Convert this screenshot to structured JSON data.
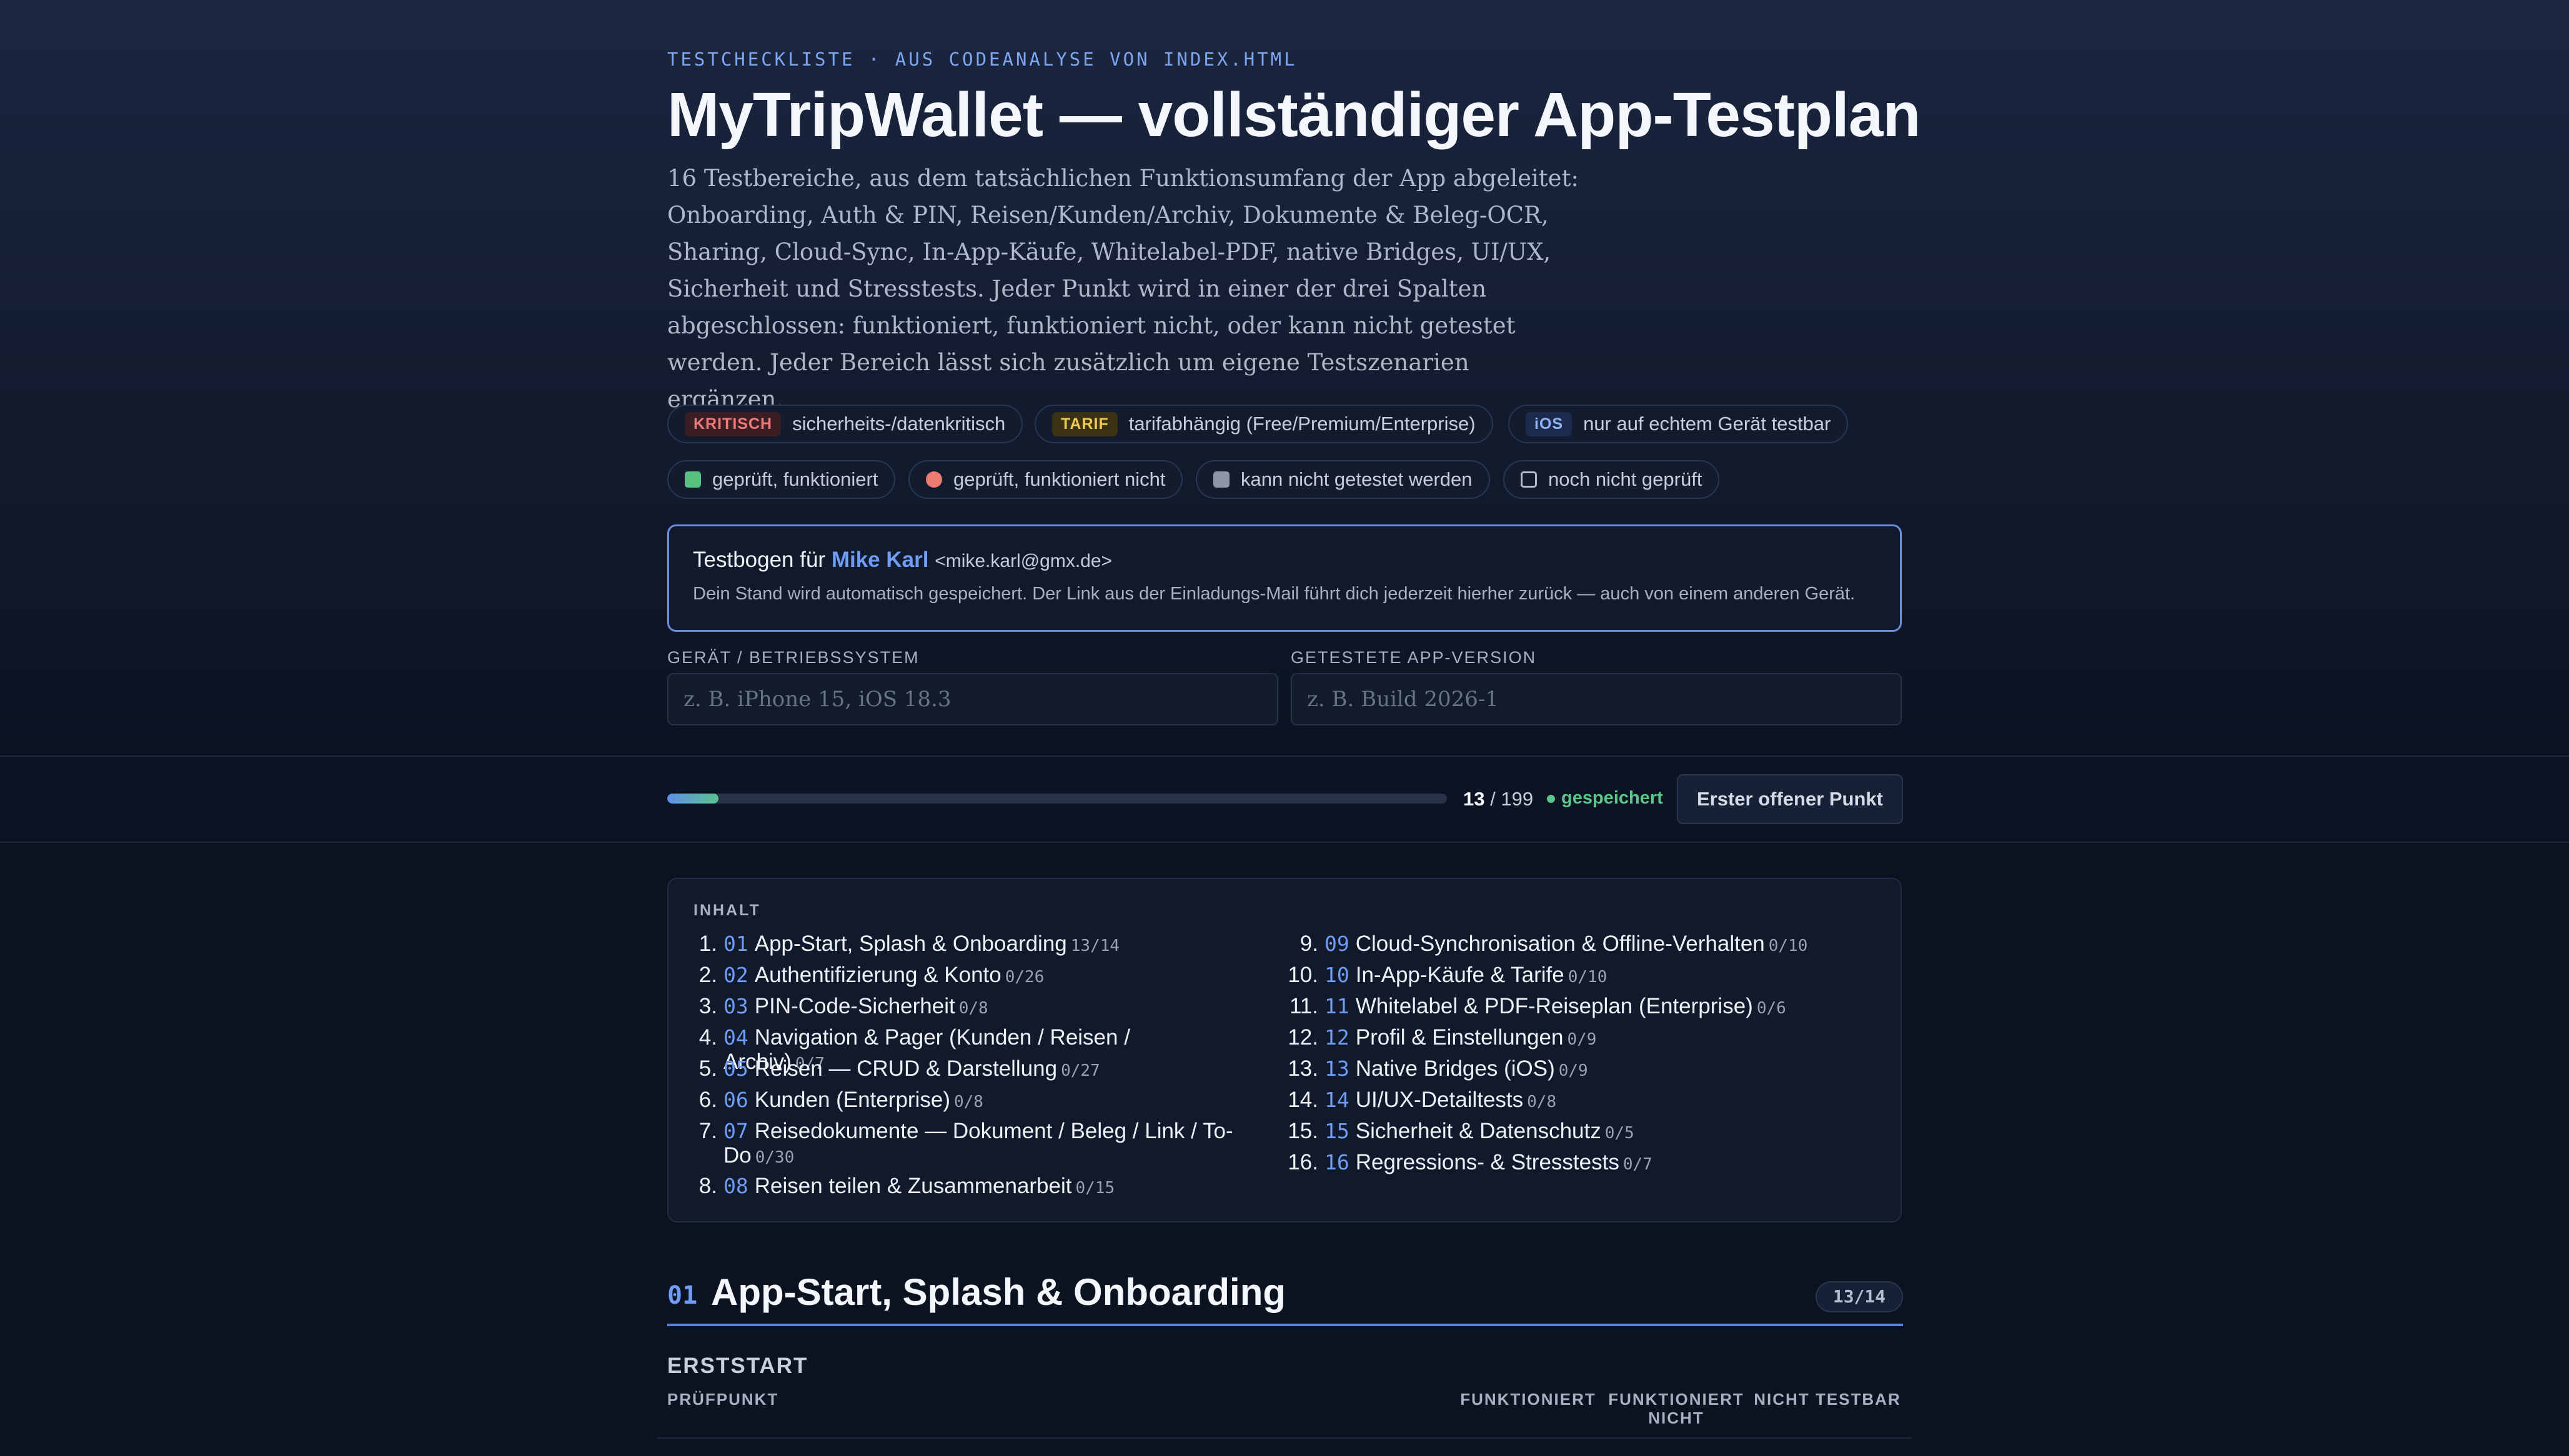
{
  "header": {
    "kicker": "TESTCHECKLISTE · AUS CODEANALYSE VON INDEX.HTML",
    "title": "MyTripWallet — vollständiger App-Testplan",
    "intro": "16 Testbereiche, aus dem tatsächlichen Funktionsumfang der App abgeleitet: Onboarding, Auth & PIN, Reisen/Kunden/Archiv, Dokumente & Beleg-OCR, Sharing, Cloud-Sync, In-App-Käufe, Whitelabel-PDF, native Bridges, UI/UX, Sicherheit und Stresstests. Jeder Punkt wird in einer der drei Spalten abgeschlossen: funktioniert, funktioniert nicht, oder kann nicht getestet werden. Jeder Bereich lässt sich zusätzlich um eigene Testszenarien ergänzen."
  },
  "legend": {
    "tags": [
      {
        "tag": "KRITISCH",
        "text": "sicherheits-/datenkritisch",
        "color": "#f07a7a"
      },
      {
        "tag": "TARIF",
        "text": "tarifabhängig (Free/Premium/Enterprise)",
        "color": "#f2cb55"
      },
      {
        "tag": "iOS",
        "text": "nur auf echtem Gerät testbar",
        "color": "#8fb3f5"
      }
    ],
    "states": [
      {
        "text": "geprüft, funktioniert",
        "color": "#55c07f"
      },
      {
        "text": "geprüft, funktioniert nicht",
        "color": "#ec7c72"
      },
      {
        "text": "kann nicht getestet werden",
        "color": "#8d97a8"
      },
      {
        "text": "noch nicht geprüft",
        "color": "transparent"
      }
    ]
  },
  "invite": {
    "prefix": "Testbogen für",
    "name": "Mike Karl",
    "email": "<mike.karl@gmx.de>",
    "note": "Dein Stand wird automatisch gespeichert. Der Link aus der Einladungs-Mail führt dich jederzeit hierher zurück — auch von einem anderen Gerät."
  },
  "fields": {
    "device_label": "GERÄT / BETRIEBSSYSTEM",
    "device_value": "",
    "device_placeholder": "z. B. iPhone 15, iOS 18.3",
    "version_label": "GETESTETE APP-VERSION",
    "version_value": "",
    "version_placeholder": "z. B. Build 2026-1"
  },
  "progress": {
    "done": 13,
    "total": 199,
    "separator": "/",
    "saved_label": "gespeichert",
    "jump_label": "Erster offener Punkt"
  },
  "toc": {
    "heading": "INHALT",
    "items": [
      {
        "idx": "1.",
        "num": "01",
        "label": "App-Start, Splash & Onboarding",
        "count": "13/14"
      },
      {
        "idx": "2.",
        "num": "02",
        "label": "Authentifizierung & Konto",
        "count": "0/26"
      },
      {
        "idx": "3.",
        "num": "03",
        "label": "PIN-Code-Sicherheit",
        "count": "0/8"
      },
      {
        "idx": "4.",
        "num": "04",
        "label": "Navigation & Pager (Kunden / Reisen / Archiv)",
        "count": "0/7"
      },
      {
        "idx": "5.",
        "num": "05",
        "label": "Reisen — CRUD & Darstellung",
        "count": "0/27"
      },
      {
        "idx": "6.",
        "num": "06",
        "label": "Kunden (Enterprise)",
        "count": "0/8"
      },
      {
        "idx": "7.",
        "num": "07",
        "label": "Reisedokumente — Dokument / Beleg / Link / To-Do",
        "count": "0/30"
      },
      {
        "idx": "8.",
        "num": "08",
        "label": "Reisen teilen & Zusammenarbeit",
        "count": "0/15"
      },
      {
        "idx": "9.",
        "num": "09",
        "label": "Cloud-Synchronisation & Offline-Verhalten",
        "count": "0/10"
      },
      {
        "idx": "10.",
        "num": "10",
        "label": "In-App-Käufe & Tarife",
        "count": "0/10"
      },
      {
        "idx": "11.",
        "num": "11",
        "label": "Whitelabel & PDF-Reiseplan (Enterprise)",
        "count": "0/6"
      },
      {
        "idx": "12.",
        "num": "12",
        "label": "Profil & Einstellungen",
        "count": "0/9"
      },
      {
        "idx": "13.",
        "num": "13",
        "label": "Native Bridges (iOS)",
        "count": "0/9"
      },
      {
        "idx": "14.",
        "num": "14",
        "label": "UI/UX-Detailtests",
        "count": "0/8"
      },
      {
        "idx": "15.",
        "num": "15",
        "label": "Sicherheit & Datenschutz",
        "count": "0/5"
      },
      {
        "idx": "16.",
        "num": "16",
        "label": "Regressions- & Stresstests",
        "count": "0/7"
      }
    ]
  },
  "section": {
    "num": "01",
    "title": "App-Start, Splash & Onboarding",
    "count": "13/14",
    "group": "ERSTSTART",
    "columns": {
      "item": "PRÜFPUNKT",
      "works": "FUNKTIONIERT",
      "fails": "FUNKTIONIERT NICHT",
      "untestable": "NICHT TESTBAR"
    }
  },
  "colors": {
    "accent": "#6f9cf5",
    "success": "#55c07f",
    "danger": "#ec7c72",
    "background": "#0b1220"
  }
}
